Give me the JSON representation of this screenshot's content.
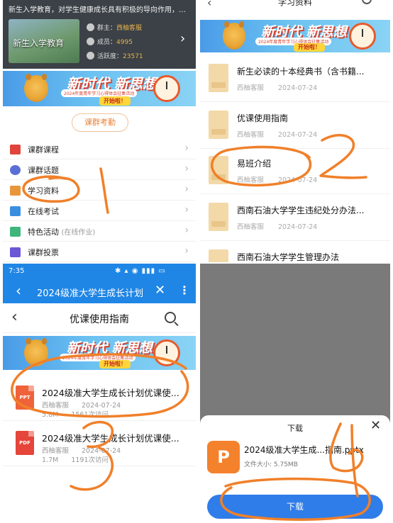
{
  "panel1": {
    "intro": "新生入学教育，对学生健康成长具有积极的导向作用，为此西南...",
    "group_thumb_title": "新生入学教育",
    "stats": [
      {
        "icon": "person-icon",
        "label": "群主：",
        "value": "西柚客服"
      },
      {
        "icon": "members-icon",
        "label": "成员：",
        "value": "4995"
      },
      {
        "icon": "fire-icon",
        "label": "活跃度：",
        "value": "23571"
      }
    ],
    "banner": {
      "title": "新时代 新思想",
      "subtitle": "2024年度青年学习心得体会征集活动",
      "cta": "开始啦！"
    },
    "attendance_button": "课群考勤",
    "menu": [
      {
        "label": "课群课程",
        "extra": "",
        "icon": "book-icon",
        "color": "#e0443b"
      },
      {
        "label": "课群话题",
        "extra": "",
        "icon": "chat-icon",
        "color": "#5a6fd6"
      },
      {
        "label": "学习资料",
        "extra": "",
        "icon": "materials-icon",
        "color": "#e8963a"
      },
      {
        "label": "在线考试",
        "extra": "",
        "icon": "laptop-icon",
        "color": "#3a8ee0"
      },
      {
        "label": "特色活动",
        "extra": "(在线作业)",
        "icon": "clipboard-icon",
        "color": "#3fb57c"
      },
      {
        "label": "课群投票",
        "extra": "",
        "icon": "vote-icon",
        "color": "#6a57d6"
      }
    ]
  },
  "panel2": {
    "header_title": "学习资料",
    "files": [
      {
        "title": "新生必读的十本经典书（含书籍...",
        "author": "西柚客服",
        "date": "2024-07-24"
      },
      {
        "title": "优课使用指南",
        "author": "西柚客服",
        "date": "2024-07-24"
      },
      {
        "title": "易班介绍",
        "author": "西柚客服",
        "date": "2024-07-24"
      },
      {
        "title": "西南石油大学学生违纪处分办法...",
        "author": "西柚客服",
        "date": "2024-07-24"
      },
      {
        "title": "西南石油大学学生管理办法",
        "author": "",
        "date": ""
      }
    ]
  },
  "panel3": {
    "time": "7:35",
    "status_icons": "✱ ▴ ◉ ▮▮▮ ▭",
    "app_title": "2024级准大学生成长计划",
    "nav_title": "优课使用指南",
    "docs": [
      {
        "type": "PPT",
        "color": "#f0623a",
        "title": "2024级准大学生成长计划优课使...",
        "author": "西柚客服",
        "date": "2024-07-24",
        "size": "5.8M",
        "views": "1561次访问"
      },
      {
        "type": "PDF",
        "color": "#e5453a",
        "title": "2024级准大学生成长计划优课使...",
        "author": "西柚客服",
        "date": "2024-07-24",
        "size": "1.7M",
        "views": "1191次访问"
      }
    ]
  },
  "panel4": {
    "sheet_title": "下载",
    "file_icon_letter": "P",
    "file_name": "2024级准大学生成...指南.pptx",
    "file_size": "文件大小: 5.75MB",
    "download_button": "下载"
  },
  "annotations": [
    "1",
    "2",
    "3",
    "4"
  ]
}
